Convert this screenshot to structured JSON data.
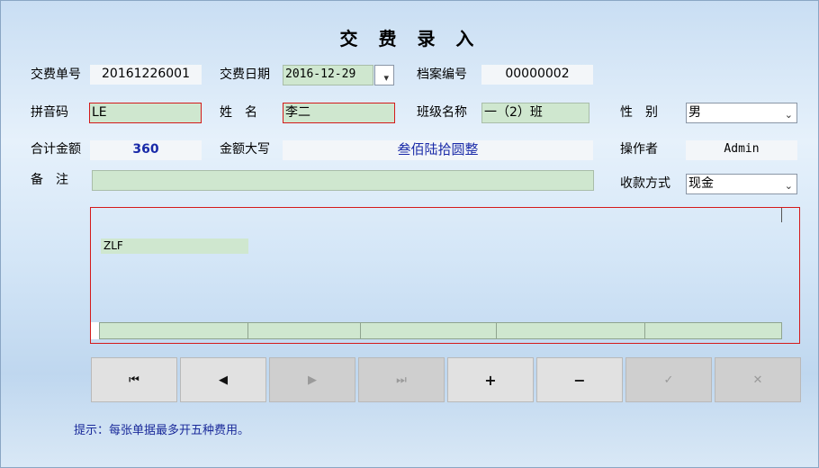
{
  "title": "交 费 录 入",
  "fields": {
    "receipt_no_label": "交费单号",
    "receipt_no": "20161226001",
    "pay_date_label": "交费日期",
    "pay_date": "2016-12-29",
    "archive_no_label": "档案编号",
    "archive_no": "00000002",
    "pinyin_label": "拼音码",
    "pinyin": "LE",
    "name_label": "姓　名",
    "name": "李二",
    "class_label": "班级名称",
    "class_name": "一（2）班",
    "gender_label": "性　别",
    "gender": "男",
    "total_label": "合计金额",
    "total": "360",
    "amount_upper_label": "金额大写",
    "amount_upper": "叁佰陆拾圆整",
    "operator_label": "操作者",
    "operator": "Admin",
    "remark_label": "备　注",
    "remark": "",
    "pay_method_label": "收款方式",
    "pay_method": "现金"
  },
  "grid": {
    "editor_value": "ZLF"
  },
  "nav": {
    "first": "⏮",
    "prev": "◀",
    "next": "▶",
    "last": "⏭",
    "add": "+",
    "delete": "−",
    "confirm": "✓",
    "cancel": "✕"
  },
  "tip": "提示：每张单据最多开五种费用。",
  "colors": {
    "input_green": "#cfe7cf",
    "error_border": "#d41a1a",
    "total_blue": "#1a2aa8",
    "tip_blue": "#1a2a9a"
  }
}
